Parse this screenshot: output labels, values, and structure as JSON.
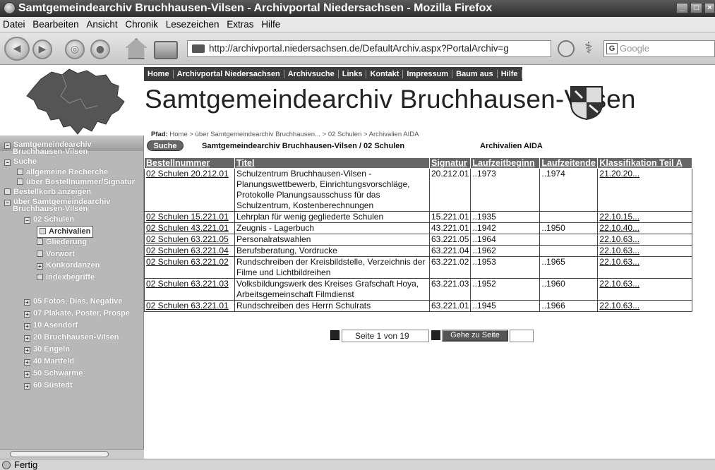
{
  "window": {
    "title": "Samtgemeindearchiv Bruchhausen-Vilsen - Archivportal Niedersachsen - Mozilla Firefox"
  },
  "menu": [
    "Datei",
    "Bearbeiten",
    "Ansicht",
    "Chronik",
    "Lesezeichen",
    "Extras",
    "Hilfe"
  ],
  "url": "http://archivportal.niedersachsen.de/DefaultArchiv.aspx?PortalArchiv=g",
  "search": {
    "placeholder": "Google"
  },
  "topnav": [
    "Home",
    "Archivportal Niedersachsen",
    "Archivsuche",
    "Links",
    "Kontakt",
    "Impressum",
    "Baum aus",
    "Hilfe"
  ],
  "site_title": "Samtgemeindearchiv Bruchhausen-Vilsen",
  "breadcrumb": {
    "label": "Pfad:",
    "path": "Home > über Samtgemeindearchiv Bruchhausen... > 02 Schulen > Archivalien AIDA"
  },
  "suche_button": "Suche",
  "subhead_left": "Samtgemeindearchiv Bruchhausen-Vilsen / 02 Schulen",
  "subhead_right": "Archivalien AIDA",
  "tree": [
    {
      "label": "Samtgemeindearchiv",
      "icon": "minus"
    },
    {
      "label": "Bruchhausen-Vilsen",
      "icon": ""
    },
    {
      "label": "Suche",
      "icon": "minus"
    },
    {
      "label": "allgemeine Recherche",
      "icon": "doc"
    },
    {
      "label": "über Bestellnummer/Signatur",
      "icon": "doc"
    },
    {
      "label": "Bestellkorb anzeigen",
      "icon": "doc"
    },
    {
      "label": "über Samtgemeindearchiv",
      "icon": "minus"
    },
    {
      "label": "Bruchhausen-Vilsen",
      "icon": ""
    },
    {
      "label": "02 Schulen",
      "icon": "minus"
    },
    {
      "label": "Archivalien",
      "icon": "doc",
      "active": true
    },
    {
      "label": "Gliederung",
      "icon": "doc"
    },
    {
      "label": "Vorwort",
      "icon": "doc"
    },
    {
      "label": "Konkordanzen",
      "icon": "plus"
    },
    {
      "label": "Indexbegriffe",
      "icon": "doc"
    },
    {
      "label": "05 Fotos, Dias, Negative",
      "icon": "plus"
    },
    {
      "label": "07 Plakate, Poster, Prospe",
      "icon": "plus"
    },
    {
      "label": "10 Asendorf",
      "icon": "plus"
    },
    {
      "label": "20 Bruchhausen-Vilsen",
      "icon": "plus"
    },
    {
      "label": "30 Engeln",
      "icon": "plus"
    },
    {
      "label": "40 Martfeld",
      "icon": "plus"
    },
    {
      "label": "50 Schwarme",
      "icon": "plus"
    },
    {
      "label": "60 Süstedt",
      "icon": "plus"
    }
  ],
  "table": {
    "headers": [
      "Bestellnummer",
      "Titel",
      "Signatur",
      "Laufzeitbeginn",
      "Laufzeitende",
      "Klassifikation Teil A"
    ],
    "rows": [
      [
        "02 Schulen 20.212.01",
        "Schulzentrum Bruchhausen-Vilsen - Planungswettbewerb, Einrichtungsvorschläge, Protokolle Planungsausschuss für das Schulzentrum, Kostenberechnungen",
        "20.212.01",
        "..1973",
        "..1974",
        "21.20.20..."
      ],
      [
        "02 Schulen 15.221.01",
        "Lehrplan für wenig gegliederte Schulen",
        "15.221.01",
        "..1935",
        "",
        "22.10.15..."
      ],
      [
        "02 Schulen 43.221.01",
        "Zeugnis - Lagerbuch",
        "43.221.01",
        "..1942",
        "..1950",
        "22.10.40..."
      ],
      [
        "02 Schulen 63.221.05",
        "Personalratswahlen",
        "63.221.05",
        "..1964",
        "",
        "22.10.63..."
      ],
      [
        "02 Schulen 63.221.04",
        "Berufsberatung, Vordrucke",
        "63.221.04",
        "..1962",
        "",
        "22.10.63..."
      ],
      [
        "02 Schulen 63.221.02",
        "Rundschreiben der Kreisbildstelle, Verzeichnis der Filme und Lichtbildreihen",
        "63.221.02",
        "..1953",
        "..1965",
        "22.10.63..."
      ],
      [
        "02 Schulen 63.221.03",
        "Volksbildungswerk des Kreises Grafschaft Hoya, Arbeitsgemeinschaft Filmdienst",
        "63.221.03",
        "..1952",
        "..1960",
        "22.10.63..."
      ],
      [
        "02 Schulen 63.221.01",
        "Rundschreiben des Herrn Schulrats",
        "63.221.01",
        "..1945",
        "..1966",
        "22.10.63..."
      ]
    ]
  },
  "pager": {
    "page_text": "Seite 1 von 19",
    "goto_label": "Gehe zu Seite"
  },
  "status": "Fertig"
}
